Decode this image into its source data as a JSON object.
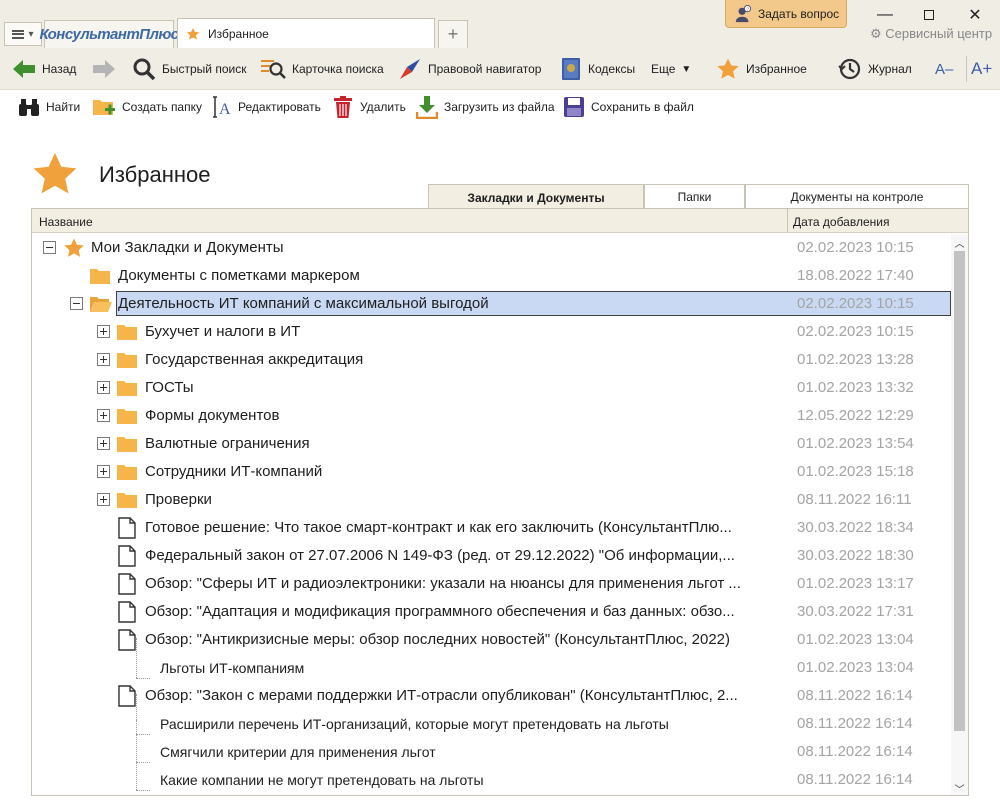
{
  "window": {
    "brand": "КонсультантПлюс",
    "active_tab": "Избранное",
    "ask_button": "Задать вопрос",
    "service_center": "Сервисный центр"
  },
  "toolbar": {
    "back": "Назад",
    "quick_search": "Быстрый поиск",
    "search_card": "Карточка поиска",
    "legal_navigator": "Правовой навигатор",
    "codes": "Кодексы",
    "more": "Еще",
    "favorites": "Избранное",
    "journal": "Журнал",
    "font_smaller": "A–",
    "font_larger": "A+"
  },
  "actions": {
    "find": "Найти",
    "create_folder": "Создать папку",
    "edit": "Редактировать",
    "delete": "Удалить",
    "load_file": "Загрузить из файла",
    "save_file": "Сохранить в файл"
  },
  "page": {
    "title": "Избранное"
  },
  "tabs": [
    "Закладки и Документы",
    "Папки",
    "Документы на контроле"
  ],
  "grid": {
    "col_name": "Название",
    "col_date": "Дата добавления",
    "rows": [
      {
        "label": "Мои Закладки и Документы",
        "date": "02.02.2023 10:15"
      },
      {
        "label": "Документы с пометками маркером",
        "date": "18.08.2022 17:40"
      },
      {
        "label": "Деятельность ИТ компаний с максимальной выгодой",
        "date": "02.02.2023 10:15"
      },
      {
        "label": "Бухучет и налоги в ИТ",
        "date": "02.02.2023 10:15"
      },
      {
        "label": "Государственная аккредитация",
        "date": "01.02.2023 13:28"
      },
      {
        "label": "ГОСТы",
        "date": "01.02.2023 13:32"
      },
      {
        "label": "Формы документов",
        "date": "12.05.2022 12:29"
      },
      {
        "label": "Валютные ограничения",
        "date": "01.02.2023 13:54"
      },
      {
        "label": "Сотрудники ИТ-компаний",
        "date": "01.02.2023 15:18"
      },
      {
        "label": "Проверки",
        "date": "08.11.2022 16:11"
      },
      {
        "label": "Готовое решение: Что такое смарт-контракт и как его заключить (КонсультантПлю...",
        "date": "30.03.2022 18:34"
      },
      {
        "label": "Федеральный закон от 27.07.2006 N 149-ФЗ (ред. от 29.12.2022) \"Об информации,...",
        "date": "30.03.2022 18:30"
      },
      {
        "label": "Обзор: \"Сферы ИТ и радиоэлектроники: указали на нюансы для применения льгот ...",
        "date": "01.02.2023 13:17"
      },
      {
        "label": "Обзор: \"Адаптация и модификация программного обеспечения и баз данных: обзо...",
        "date": "30.03.2022 17:31"
      },
      {
        "label": "Обзор: \"Антикризисные меры: обзор последних новостей\" (КонсультантПлюс, 2022)",
        "date": "01.02.2023 13:04"
      },
      {
        "label": "Льготы ИТ-компаниям",
        "date": "01.02.2023 13:04"
      },
      {
        "label": "Обзор: \"Закон с мерами поддержки ИТ-отрасли опубликован\" (КонсультантПлюс, 2...",
        "date": "08.11.2022 16:14"
      },
      {
        "label": "Расширили перечень ИТ-организаций, которые могут претендовать на льготы",
        "date": "08.11.2022 16:14"
      },
      {
        "label": "Смягчили критерии для применения льгот",
        "date": "08.11.2022 16:14"
      },
      {
        "label": "Какие компании не могут претендовать на льготы",
        "date": "08.11.2022 16:14"
      }
    ]
  },
  "colors": {
    "chrome": "#f0ede5",
    "selection": "#c9d9f4",
    "star": "#f0a13b",
    "folder": "#f5b54a",
    "date_text": "#a4a4a4"
  }
}
